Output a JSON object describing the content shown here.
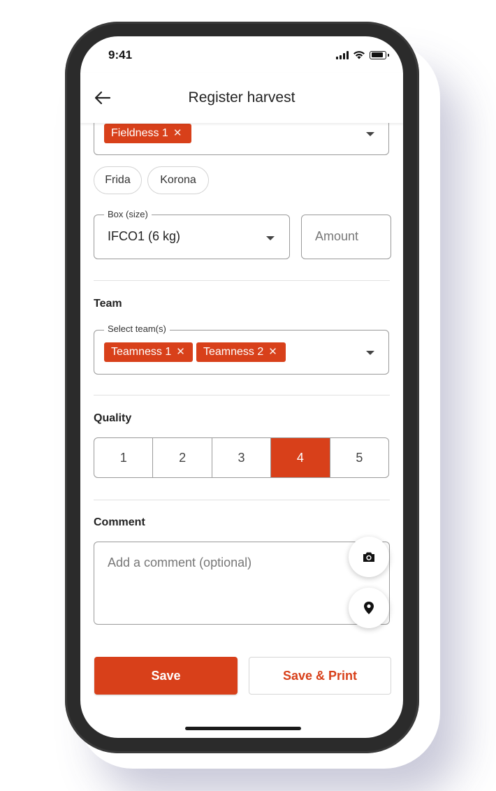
{
  "status_bar": {
    "time": "9:41"
  },
  "appbar": {
    "title": "Register harvest"
  },
  "field_select": {
    "chips": [
      {
        "label": "Fieldness 1"
      }
    ]
  },
  "varieties": [
    {
      "label": "Frida"
    },
    {
      "label": "Korona"
    }
  ],
  "box": {
    "legend": "Box (size)",
    "value": "IFCO1 (6 kg)",
    "amount_placeholder": "Amount"
  },
  "team": {
    "heading": "Team",
    "legend": "Select team(s)",
    "chips": [
      {
        "label": "Teamness 1"
      },
      {
        "label": "Teamness 2"
      }
    ]
  },
  "quality": {
    "heading": "Quality",
    "options": [
      "1",
      "2",
      "3",
      "4",
      "5"
    ],
    "selected": "4"
  },
  "comment": {
    "heading": "Comment",
    "placeholder": "Add a comment (optional)"
  },
  "actions": {
    "save_label": "Save",
    "save_print_label": "Save & Print"
  },
  "colors": {
    "accent": "#d8401a",
    "border": "#9a9a9a",
    "divider": "#e1e1e1"
  },
  "icons": {
    "back": "arrow-left-icon",
    "remove": "close-icon",
    "dropdown": "caret-down-icon",
    "camera": "camera-icon",
    "location": "location-pin-icon",
    "signal": "cellular-signal-icon",
    "wifi": "wifi-icon",
    "battery": "battery-icon"
  }
}
